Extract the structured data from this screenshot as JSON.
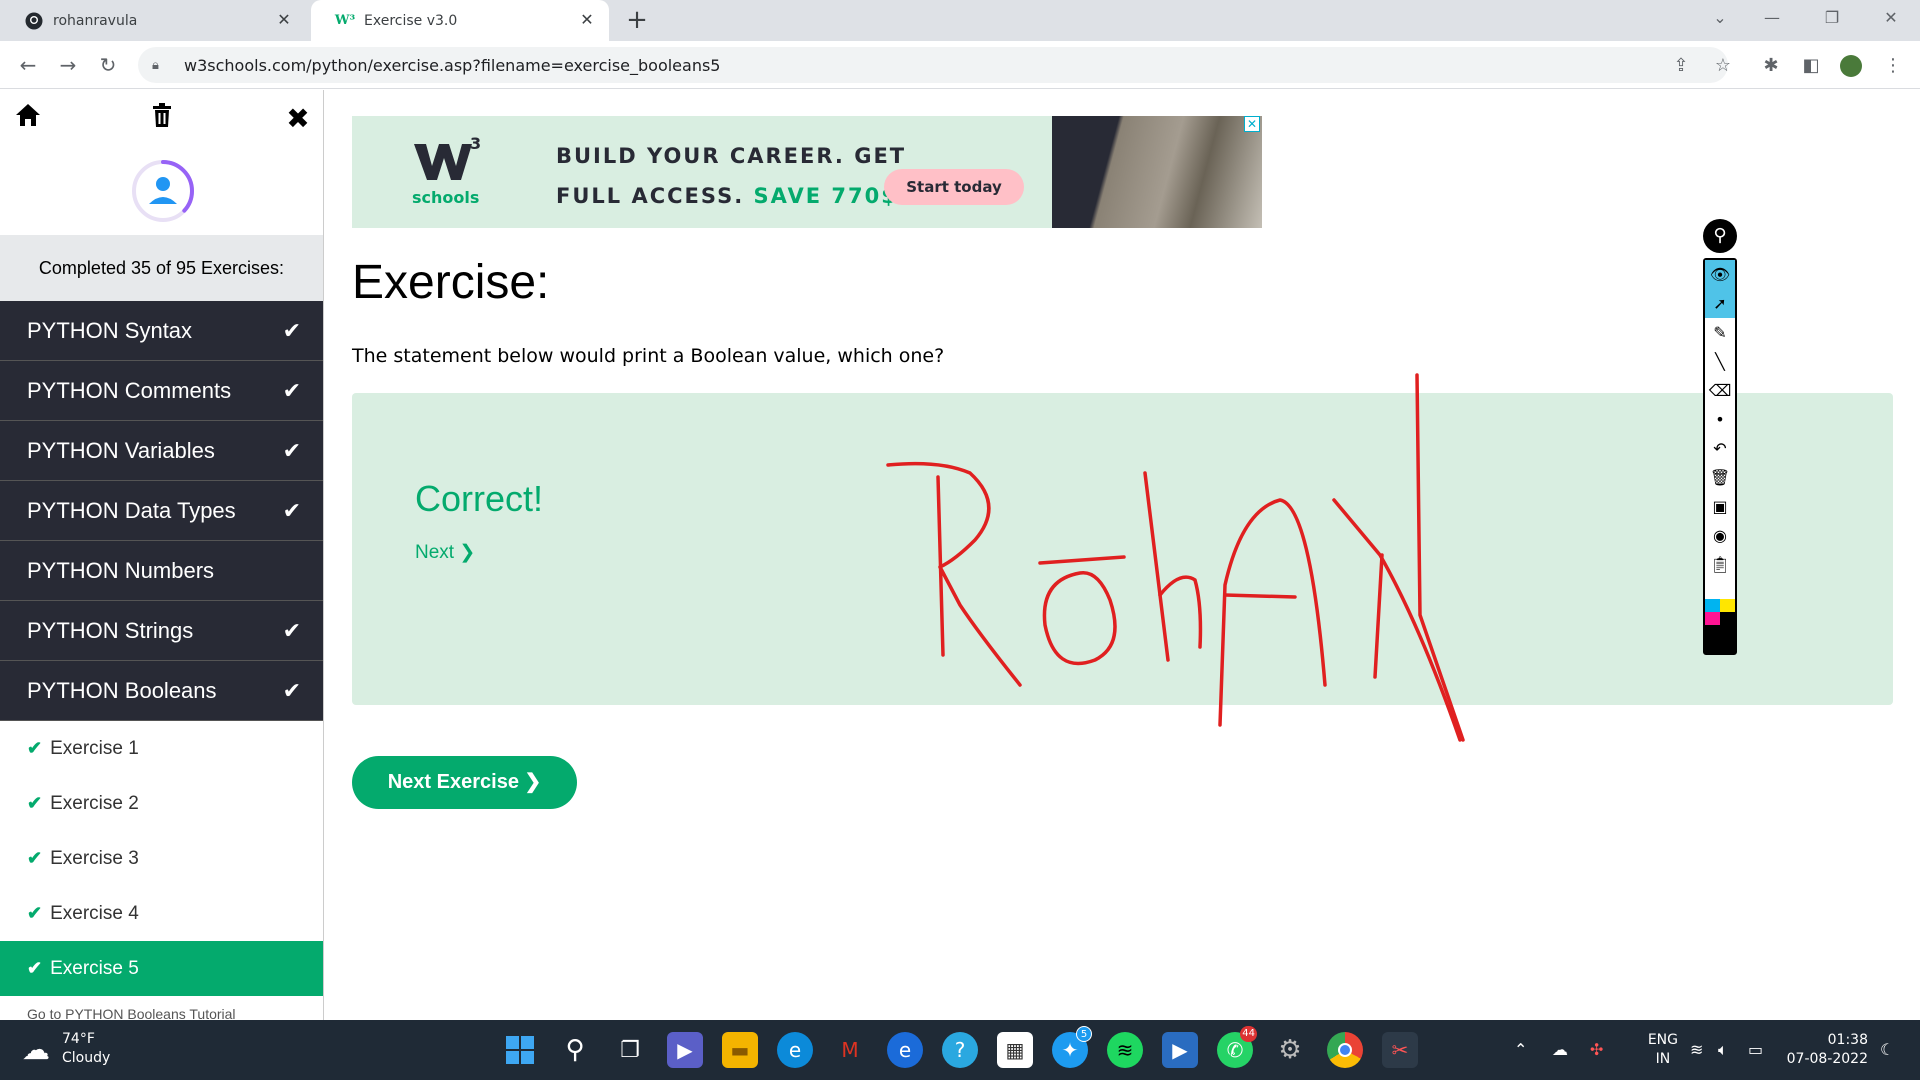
{
  "browser": {
    "tabs": [
      {
        "title": "rohanravula",
        "active": false
      },
      {
        "title": "Exercise v3.0",
        "active": true
      }
    ],
    "url": "w3schools.com/python/exercise.asp?filename=exercise_booleans5"
  },
  "sidebar": {
    "completed_text": "Completed 35 of 95 Exercises:",
    "progress_fraction": 0.368,
    "sections": [
      {
        "label": "PYTHON Syntax",
        "done": true
      },
      {
        "label": "PYTHON Comments",
        "done": true
      },
      {
        "label": "PYTHON Variables",
        "done": true
      },
      {
        "label": "PYTHON Data Types",
        "done": true
      },
      {
        "label": "PYTHON Numbers",
        "done": false
      },
      {
        "label": "PYTHON Strings",
        "done": true
      },
      {
        "label": "PYTHON Booleans",
        "done": true
      }
    ],
    "exercises": [
      {
        "label": "Exercise 1"
      },
      {
        "label": "Exercise 2"
      },
      {
        "label": "Exercise 3"
      },
      {
        "label": "Exercise 4"
      },
      {
        "label": "Exercise 5",
        "active": true
      }
    ],
    "goto_tutorial": "Go to PYTHON Booleans Tutorial"
  },
  "ad": {
    "logo_text": "schools",
    "logo_sup": "3",
    "headline_1": "BUILD YOUR CAREER. GET",
    "headline_2": "FULL ACCESS.",
    "headline_save": "SAVE 770$",
    "cta": "Start today"
  },
  "exercise": {
    "title": "Exercise:",
    "question": "The statement below would print a Boolean value, which one?",
    "result": "Correct!",
    "next_link": "Next ❯",
    "next_button": "Next Exercise ❯"
  },
  "taskbar": {
    "temp": "74°F",
    "condition": "Cloudy",
    "twitter_badge": "5",
    "whatsapp_badge": "44",
    "lang_1": "ENG",
    "lang_2": "IN",
    "time": "01:38",
    "date": "07-08-2022"
  },
  "colors": {
    "accent": "#04aa6d",
    "sidebar_dark": "#282a35",
    "answer_bg": "#d9eee1",
    "ink": "#e02020"
  }
}
